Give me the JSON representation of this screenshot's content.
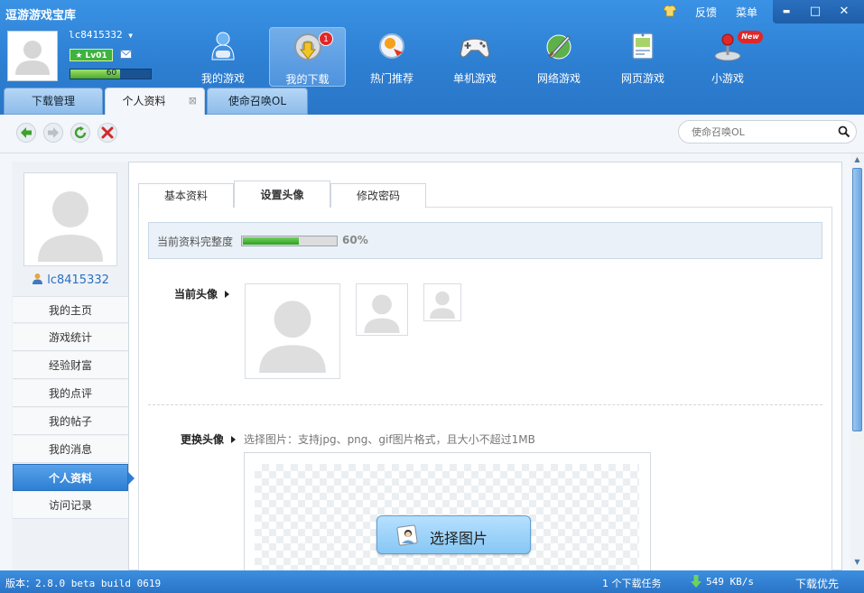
{
  "app": {
    "title": "逗游游戏宝库"
  },
  "top_links": {
    "feedback": "反馈",
    "menu": "菜单"
  },
  "window_controls": {
    "minimize": "▬",
    "maximize": "□",
    "close": "✕"
  },
  "user": {
    "name": "lc8415332",
    "level": "Lv01",
    "exp": "60",
    "exp_fraction": 0.62
  },
  "nav": [
    {
      "label": "我的游戏",
      "icon": "my-games-icon"
    },
    {
      "label": "我的下载",
      "icon": "download-icon",
      "badge": "1"
    },
    {
      "label": "热门推荐",
      "icon": "hot-recommend-icon"
    },
    {
      "label": "单机游戏",
      "icon": "gamepad-icon"
    },
    {
      "label": "网络游戏",
      "icon": "sword-icon"
    },
    {
      "label": "网页游戏",
      "icon": "web-game-icon"
    },
    {
      "label": "小游戏",
      "icon": "joystick-icon",
      "badge": "New"
    }
  ],
  "tabs": [
    {
      "label": "下载管理"
    },
    {
      "label": "个人资料",
      "close": "⊠"
    },
    {
      "label": "使命召唤OL"
    }
  ],
  "search": {
    "placeholder": "使命召唤OL"
  },
  "sidebar": {
    "username": "lc8415332",
    "items": [
      {
        "label": "我的主页"
      },
      {
        "label": "游戏统计"
      },
      {
        "label": "经验财富"
      },
      {
        "label": "我的点评"
      },
      {
        "label": "我的帖子"
      },
      {
        "label": "我的消息"
      },
      {
        "label": "个人资料"
      },
      {
        "label": "访问记录"
      }
    ]
  },
  "subtabs": [
    {
      "label": "基本资料"
    },
    {
      "label": "设置头像"
    },
    {
      "label": "修改密码"
    }
  ],
  "profile": {
    "completeness_label": "当前资料完整度",
    "completeness_value": "60%",
    "completeness_fraction": 0.6,
    "current_avatar_label": "当前头像",
    "change_avatar_label": "更换头像",
    "change_hint": "选择图片：支持jpg、png、gif图片格式，且大小不超过1MB",
    "select_button": "选择图片"
  },
  "status": {
    "version": "版本：2.8.0 beta build 0619",
    "tasks": "1 个下载任务",
    "speed": "549 KB/s",
    "priority": "下载优先"
  }
}
